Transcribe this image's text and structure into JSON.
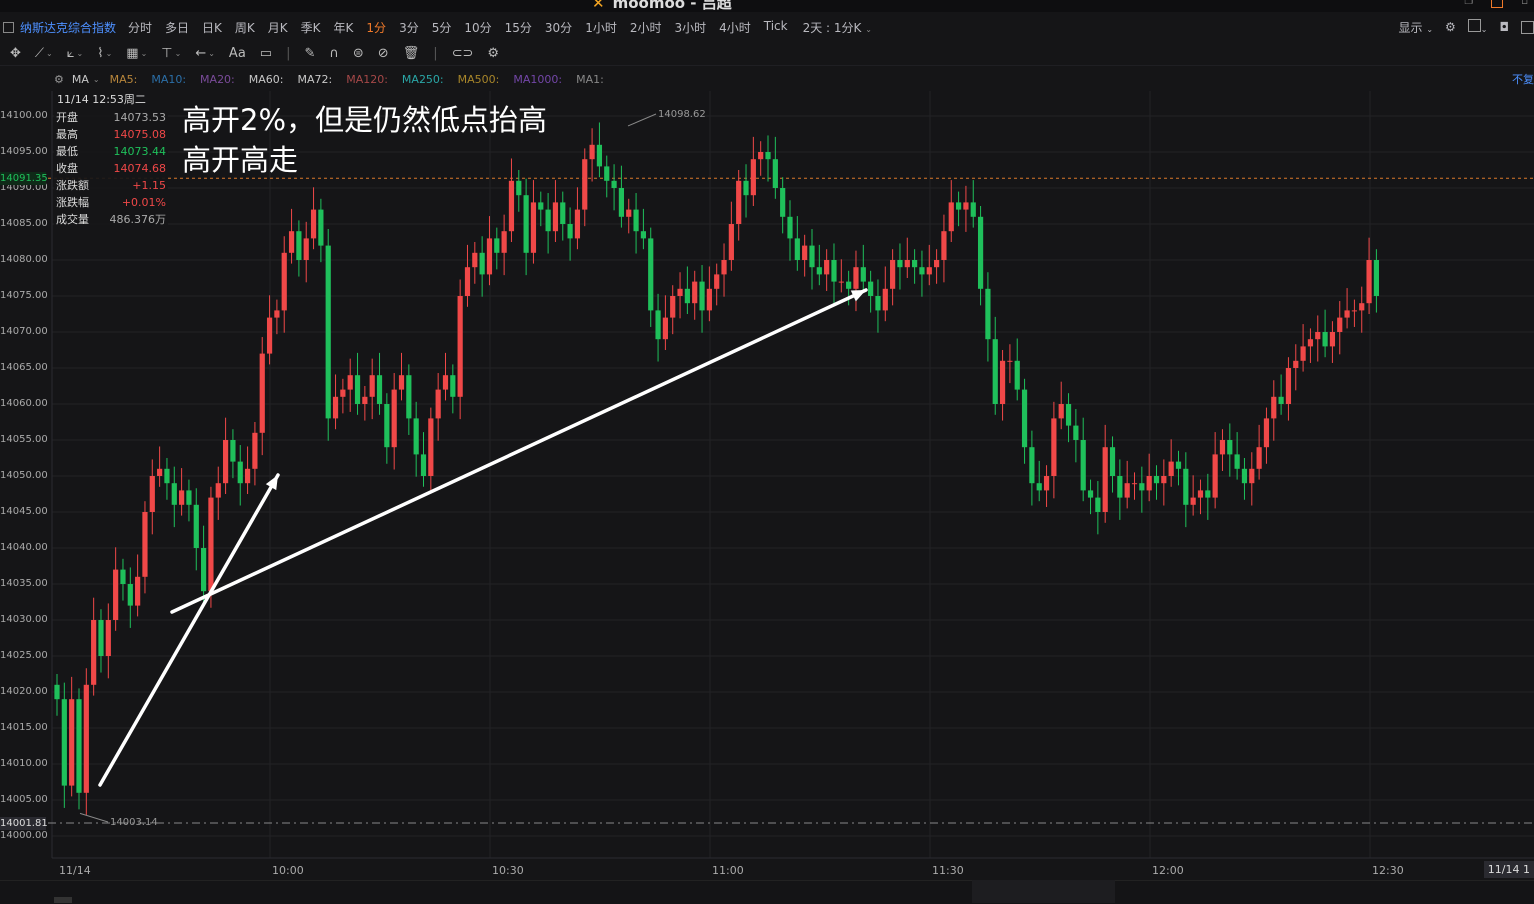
{
  "app": {
    "title": "moomoo - 吕超",
    "logo": "moomoo-logo-icon"
  },
  "toolbar": {
    "instrument": "纳斯达克综合指数",
    "periods": [
      "分时",
      "多日",
      "日K",
      "周K",
      "月K",
      "季K",
      "年K",
      "1分",
      "3分",
      "5分",
      "10分",
      "15分",
      "30分",
      "1小时",
      "2小时",
      "3小时",
      "4小时",
      "Tick"
    ],
    "active_period": "1分",
    "custom_period": "2天 : 1分K",
    "display_label": "显示"
  },
  "drawing_tools": [
    "crosshair-icon",
    "line-tool-icon",
    "trend-tool-icon",
    "wave-tool-icon",
    "grid-tool-icon",
    "measure-tool-icon",
    "arrow-tool-icon",
    "text-tool-icon",
    "comment-tool-icon",
    "pencil-icon",
    "magnet-icon",
    "lock-icon",
    "hide-icon",
    "delete-icon",
    "link-icon",
    "settings-icon"
  ],
  "text_tool_label": "Aa",
  "indicators": {
    "main": "MA",
    "items": [
      {
        "label": "MA5:",
        "color": "#b8863b"
      },
      {
        "label": "MA10:",
        "color": "#2b6fa8"
      },
      {
        "label": "MA20:",
        "color": "#7a4b9a"
      },
      {
        "label": "MA60:",
        "color": "#c8c8c8"
      },
      {
        "label": "MA72:",
        "color": "#c8c8c8"
      },
      {
        "label": "MA120:",
        "color": "#a54848"
      },
      {
        "label": "MA250:",
        "color": "#2aa7a7"
      },
      {
        "label": "MA500:",
        "color": "#a8862a"
      },
      {
        "label": "MA1000:",
        "color": "#7346a8"
      },
      {
        "label": "MA1:",
        "color": "#888888"
      }
    ],
    "corner_text": "不复"
  },
  "info": {
    "date": "11/14 12:53周二",
    "rows": [
      {
        "label": "开盘",
        "value": "14073.53",
        "color": "gray"
      },
      {
        "label": "最高",
        "value": "14075.08",
        "color": "red"
      },
      {
        "label": "最低",
        "value": "14073.44",
        "color": "green"
      },
      {
        "label": "收盘",
        "value": "14074.68",
        "color": "red"
      },
      {
        "label": "涨跌额",
        "value": "+1.15",
        "color": "red"
      },
      {
        "label": "涨跌幅",
        "value": "+0.01%",
        "color": "red"
      },
      {
        "label": "成交量",
        "value": "486.376万",
        "color": "gray"
      }
    ]
  },
  "annotation": {
    "line1": "高开2%，但是仍然低点抬高",
    "line2": "高开高走"
  },
  "y_axis": {
    "ticks": [
      "14100.00",
      "14095.00",
      "14090.00",
      "14085.00",
      "14080.00",
      "14075.00",
      "14070.00",
      "14065.00",
      "14060.00",
      "14055.00",
      "14050.00",
      "14045.00",
      "14040.00",
      "14035.00",
      "14030.00",
      "14025.00",
      "14020.00",
      "14015.00",
      "14010.00",
      "14005.00",
      "14000.00"
    ],
    "current_price": "14091.35",
    "reference_price": "14001.81"
  },
  "x_axis": {
    "ticks": [
      "11/14",
      "10:00",
      "10:30",
      "11:00",
      "11:30",
      "12:00",
      "12:30"
    ],
    "cursor_label": "11/14 1"
  },
  "chart_data": {
    "type": "candlestick",
    "x_start": "09:30",
    "interval": "1 minute",
    "high_label": "14098.62",
    "low_label": "14003.14",
    "current_price": 14091.35,
    "reference_price": 14001.81,
    "ylim": [
      14000,
      14100
    ],
    "colors": {
      "up": "#f04848",
      "down": "#1fc05b"
    },
    "closes": [
      14019,
      14007,
      14019,
      14006,
      14021,
      14030,
      14025,
      14030,
      14037,
      14035,
      14032,
      14036,
      14045,
      14050,
      14051,
      14049,
      14046,
      14048,
      14046,
      14040,
      14034,
      14047,
      14049,
      14055,
      14052,
      14049,
      14051,
      14056,
      14067,
      14072,
      14073,
      14081,
      14084,
      14080,
      14083,
      14087,
      14082,
      14058,
      14061,
      14062,
      14064,
      14060,
      14061,
      14064,
      14060,
      14054,
      14062,
      14064,
      14058,
      14053,
      14050,
      14058,
      14062,
      14064,
      14061,
      14075,
      14079,
      14081,
      14078,
      14083,
      14081,
      14084,
      14091,
      14089,
      14081,
      14088,
      14087,
      14084,
      14088,
      14085,
      14083,
      14087,
      14094,
      14096,
      14093,
      14091,
      14090,
      14086,
      14087,
      14084,
      14083,
      14073,
      14069,
      14072,
      14075,
      14076,
      14074,
      14077,
      14073,
      14076,
      14078,
      14080,
      14085,
      14091,
      14089,
      14094,
      14095,
      14094,
      14090,
      14086,
      14083,
      14080,
      14082,
      14079,
      14078,
      14080,
      14077,
      14077,
      14076,
      14079,
      14077,
      14075,
      14073,
      14076,
      14080,
      14079,
      14080,
      14079,
      14078,
      14079,
      14080,
      14084,
      14088,
      14087,
      14088,
      14086,
      14076,
      14069,
      14060,
      14066,
      14066,
      14062,
      14054,
      14049,
      14048,
      14050,
      14058,
      14060,
      14057,
      14055,
      14048,
      14047,
      14045,
      14054,
      14050,
      14047,
      14049,
      14049,
      14048,
      14050,
      14049,
      14050,
      14052,
      14051,
      14046,
      14047,
      14048,
      14047,
      14053,
      14055,
      14053,
      14051,
      14049,
      14051,
      14054,
      14058,
      14061,
      14060,
      14065,
      14066,
      14068,
      14069,
      14070,
      14068,
      14070,
      14072,
      14073,
      14073,
      14074,
      14080,
      14075
    ]
  }
}
